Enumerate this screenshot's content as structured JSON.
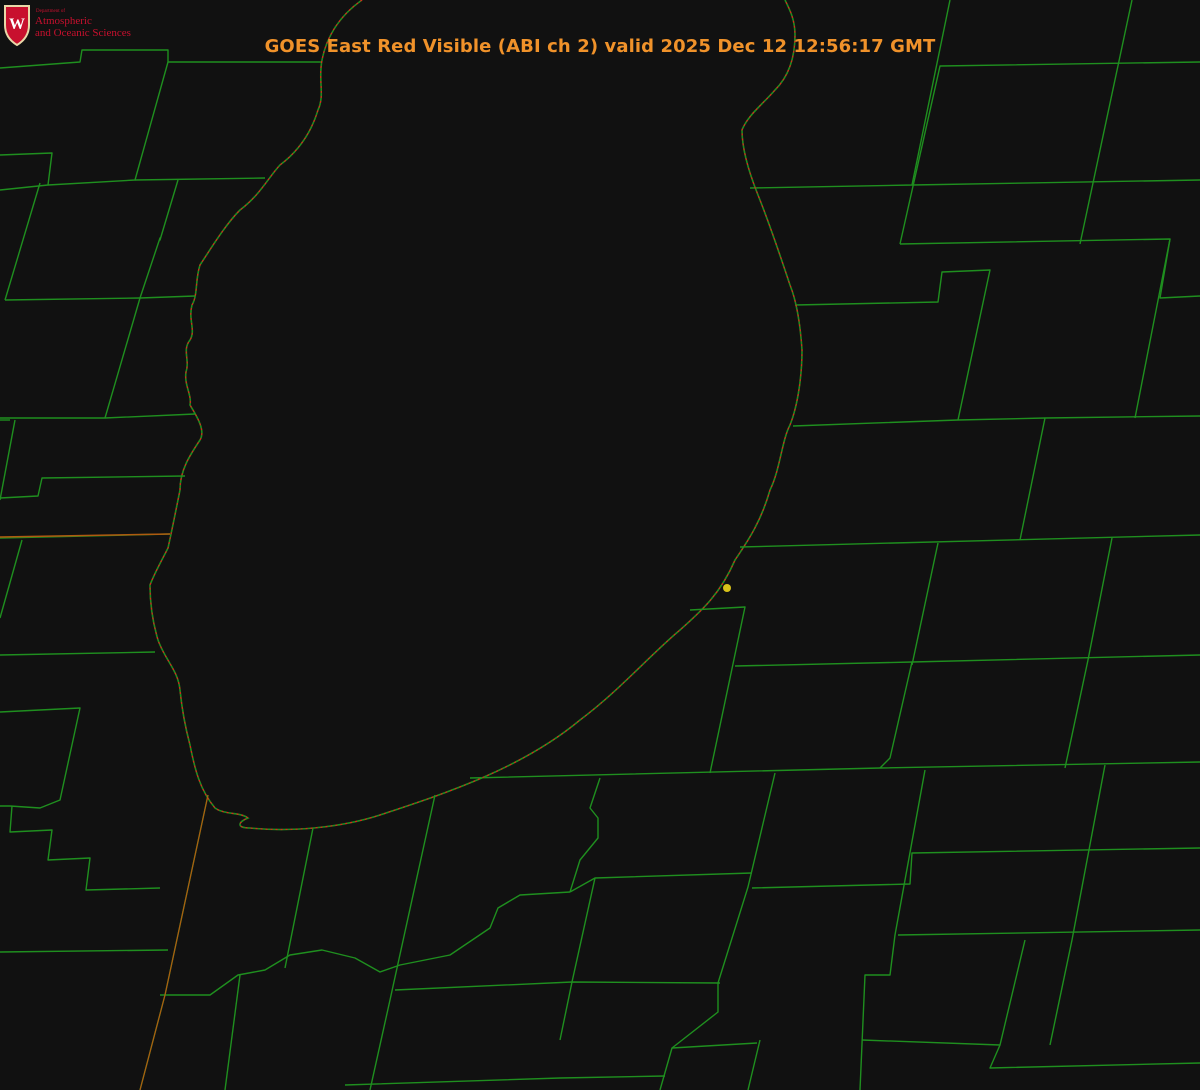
{
  "title": "GOES East Red Visible (ABI ch 2) valid 2025 Dec 12 12:56:17 GMT",
  "logo": {
    "dept_label": "Department of",
    "line1": "Atmospheric",
    "line2": "and Oceanic Sciences",
    "crest_letter": "W",
    "icon": "uw-crest-icon"
  },
  "colors": {
    "background": "#111111",
    "county_lines": "#1f8f1f",
    "shoreline_dots": "#e0201c",
    "state_line": "#b05a10",
    "title": "#f0922a",
    "marker": "#d8c21a"
  },
  "map": {
    "product": "visible satellite imagery",
    "features": [
      "county-boundaries",
      "lake-shoreline",
      "state-border",
      "point-marker"
    ]
  }
}
